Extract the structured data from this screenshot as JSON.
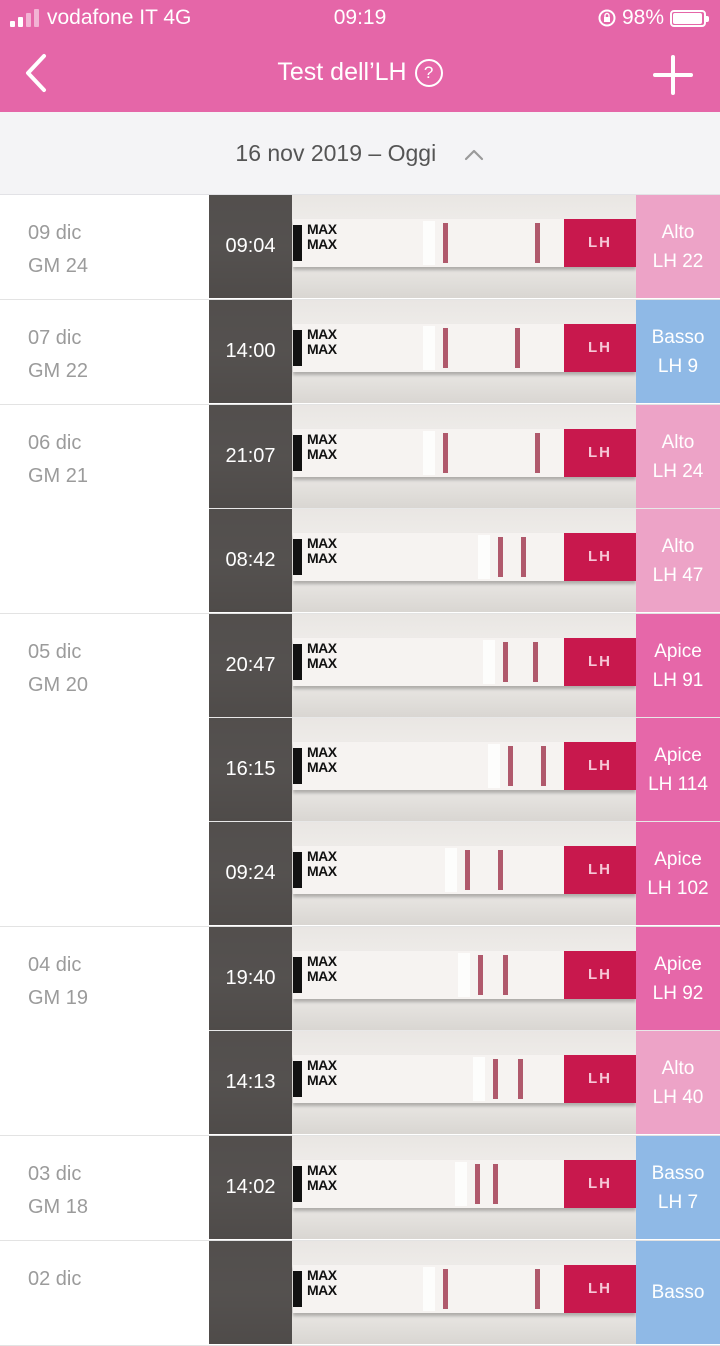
{
  "status_bar": {
    "carrier": "vodafone IT 4G",
    "time": "09:19",
    "battery": "98%",
    "battery_level": 0.98
  },
  "nav": {
    "title": "Test dell’LH",
    "help_icon": "question-circle-icon",
    "back_icon": "chevron-left-icon",
    "add_icon": "plus-icon"
  },
  "range": {
    "label": "16 nov 2019 – Oggi",
    "icon": "chevron-up-icon"
  },
  "colors": {
    "header": "#e566a8",
    "alto": "#eda3c7",
    "apice": "#e667a9",
    "basso": "#8fb9e6"
  },
  "strip_labels": {
    "max": "MAX",
    "brand": "LH"
  },
  "days": [
    {
      "date": "09 dic",
      "cycle_day": "GM 24",
      "entries": [
        {
          "time": "09:04",
          "level": "Alto",
          "lh": "LH 22",
          "kind": "alto"
        }
      ]
    },
    {
      "date": "07 dic",
      "cycle_day": "GM 22",
      "entries": [
        {
          "time": "14:00",
          "level": "Basso",
          "lh": "LH 9",
          "kind": "basso"
        }
      ]
    },
    {
      "date": "06 dic",
      "cycle_day": "GM 21",
      "entries": [
        {
          "time": "21:07",
          "level": "Alto",
          "lh": "LH 24",
          "kind": "alto"
        },
        {
          "time": "08:42",
          "level": "Alto",
          "lh": "LH 47",
          "kind": "alto"
        }
      ]
    },
    {
      "date": "05 dic",
      "cycle_day": "GM 20",
      "entries": [
        {
          "time": "20:47",
          "level": "Apice",
          "lh": "LH 91",
          "kind": "apice"
        },
        {
          "time": "16:15",
          "level": "Apice",
          "lh": "LH 114",
          "kind": "apice"
        },
        {
          "time": "09:24",
          "level": "Apice",
          "lh": "LH 102",
          "kind": "apice"
        }
      ]
    },
    {
      "date": "04 dic",
      "cycle_day": "GM 19",
      "entries": [
        {
          "time": "19:40",
          "level": "Apice",
          "lh": "LH 92",
          "kind": "apice"
        },
        {
          "time": "14:13",
          "level": "Alto",
          "lh": "LH 40",
          "kind": "alto"
        }
      ]
    },
    {
      "date": "03 dic",
      "cycle_day": "GM 18",
      "entries": [
        {
          "time": "14:02",
          "level": "Basso",
          "lh": "LH 7",
          "kind": "basso"
        }
      ]
    },
    {
      "date": "02 dic",
      "cycle_day": "",
      "entries": [
        {
          "time": "",
          "level": "Basso",
          "lh": "",
          "kind": "basso"
        }
      ]
    }
  ]
}
